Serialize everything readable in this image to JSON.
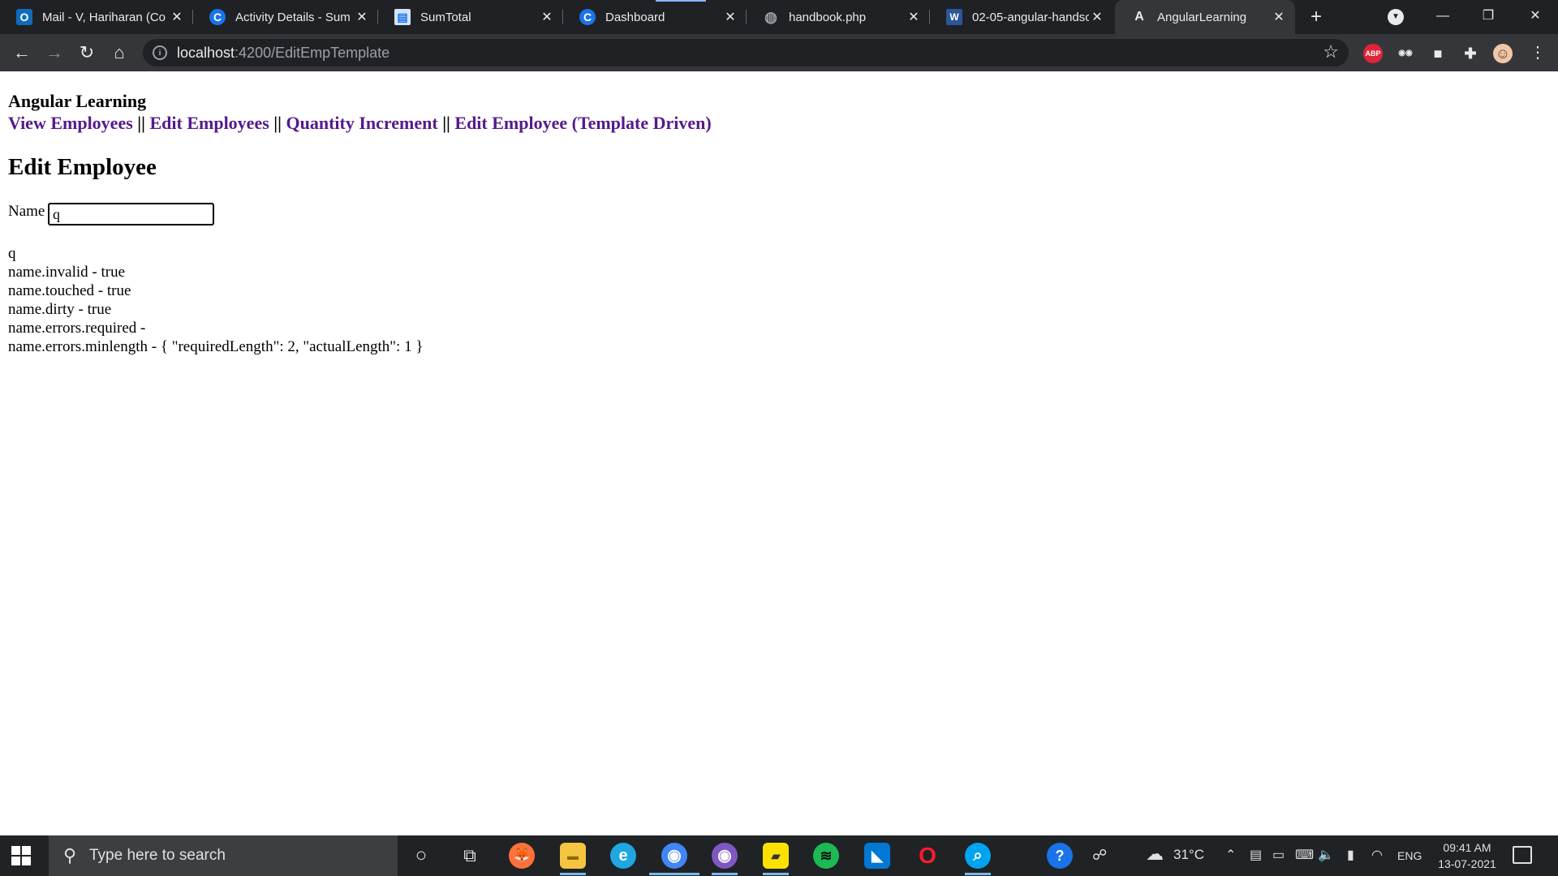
{
  "browser": {
    "tabs": [
      {
        "title": "Mail - V, Hariharan (Co",
        "icon": "outlook-icon",
        "color": "#0f6cbd",
        "glyph": "O"
      },
      {
        "title": "Activity Details - Sum",
        "icon": "sumtotal-c-icon",
        "color": "#1a73e8",
        "glyph": "C"
      },
      {
        "title": "SumTotal",
        "icon": "document-icon",
        "color": "#d2e3fc",
        "glyph": "▤"
      },
      {
        "title": "Dashboard",
        "icon": "sumtotal-c-icon",
        "color": "#1a73e8",
        "glyph": "C"
      },
      {
        "title": "handbook.php",
        "icon": "globe-icon",
        "color": "#5f6368",
        "glyph": "◍"
      },
      {
        "title": "02-05-angular-handso",
        "icon": "word-icon",
        "color": "#2b579a",
        "glyph": "W"
      },
      {
        "title": "AngularLearning",
        "icon": "angular-icon",
        "color": "#35363a",
        "glyph": "A"
      }
    ],
    "url_host": "localhost",
    "url_path": ":4200/EditEmpTemplate",
    "extensions": [
      {
        "name": "adblock-plus-icon",
        "label": "ABP",
        "color": "#e0243a"
      },
      {
        "name": "spy-glasses-icon",
        "label": "◉◉",
        "color": "#35363a"
      },
      {
        "name": "square-extension-icon",
        "label": "■",
        "color": "#9aa0a6"
      },
      {
        "name": "puzzle-extensions-icon",
        "label": "✚",
        "color": "#35363a"
      },
      {
        "name": "profile-avatar-icon",
        "label": "☺",
        "color": "#f1c6a8"
      }
    ]
  },
  "app": {
    "title": "Angular Learning",
    "nav_links": [
      "View Employees",
      "Edit Employees",
      "Quantity Increment",
      "Edit Employee (Template Driven)"
    ],
    "nav_separator": "||",
    "heading": "Edit Employee",
    "name_label": "Name",
    "name_value": "q",
    "debug_lines": [
      "q",
      "name.invalid - true",
      "name.touched - true",
      "name.dirty - true",
      "name.errors.required -",
      "name.errors.minlength - { \"requiredLength\": 2, \"actualLength\": 1 }"
    ]
  },
  "taskbar": {
    "search_placeholder": "Type here to search",
    "apps": [
      {
        "name": "cortana-icon",
        "glyph": "○",
        "color": "transparent",
        "active": false
      },
      {
        "name": "task-view-icon",
        "glyph": "⧉",
        "color": "transparent",
        "active": false
      },
      {
        "name": "firefox-icon",
        "glyph": "🦊",
        "color": "#ff7139",
        "active": false
      },
      {
        "name": "file-explorer-icon",
        "glyph": "▬",
        "color": "#f5c542",
        "active": true
      },
      {
        "name": "edge-icon",
        "glyph": "e",
        "color": "#1fa7e1",
        "active": false
      },
      {
        "name": "chrome-icon",
        "glyph": "◉",
        "color": "#4285f4",
        "active": true
      },
      {
        "name": "chrome-canary-icon",
        "glyph": "◉",
        "color": "#7e57c2",
        "active": true
      },
      {
        "name": "sticky-notes-icon",
        "glyph": "▰",
        "color": "#fce100",
        "active": true
      },
      {
        "name": "spotify-icon",
        "glyph": "≋",
        "color": "#1db954",
        "active": false
      },
      {
        "name": "vscode-icon",
        "glyph": "◣",
        "color": "#0078d4",
        "active": false
      },
      {
        "name": "opera-icon",
        "glyph": "O",
        "color": "#ff1b2d",
        "active": false
      },
      {
        "name": "search-app-icon",
        "glyph": "⌕",
        "color": "#00a4ef",
        "active": true
      }
    ],
    "weather": "31°C",
    "language": "ENG",
    "time": "09:41 AM",
    "date": "13-07-2021"
  }
}
